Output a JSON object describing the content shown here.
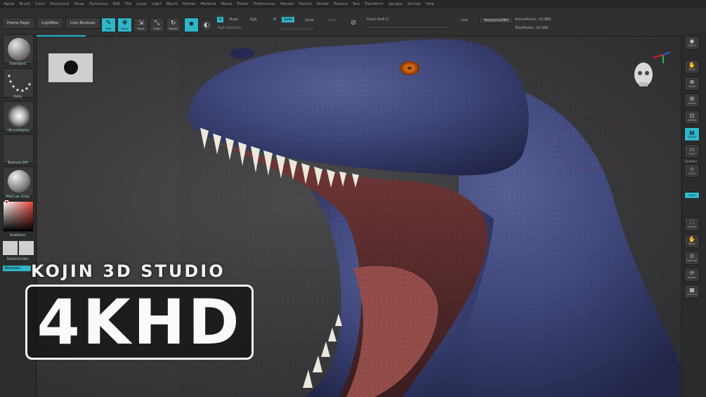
{
  "menu": [
    "Alpha",
    "Brush",
    "Color",
    "Document",
    "Draw",
    "Dynamics",
    "Edit",
    "File",
    "Layer",
    "Light",
    "Macro",
    "Marker",
    "Material",
    "Movie",
    "Picker",
    "Preferences",
    "Render",
    "Stencil",
    "Stroke",
    "Texture",
    "Tool",
    "Transform",
    "Zplugin",
    "Zscript",
    "Help"
  ],
  "toolbar": {
    "home_page": "Home Page",
    "lightbox": "LightBox",
    "live_boolean": "Live Boolean",
    "edit": "Edit",
    "draw": "Draw",
    "move": "Move",
    "scale": "Scale",
    "rotate": "Rotate",
    "a_chip": "A",
    "mrgb": "Mrgb",
    "rgb": "Rgb",
    "m": "M",
    "zadd": "Zadd",
    "zsub": "Zsub",
    "zcut": "Zcut",
    "rgb_intensity": "Rgb Intensity",
    "focal_shift": "Focal Shift 0",
    "last": "Last",
    "replay_last": "ReplayLastRel",
    "active_points": "ActivePoints: 10,968",
    "total_points": "TotalPoints: 10,968"
  },
  "left_tray": {
    "brush": "Standard",
    "stroke": "Dots",
    "alpha": "~BrushAlpha",
    "texture": "Texture Off",
    "material": "MatCap Gray",
    "gradient": "Gradient",
    "switch_color": "SwitchColor",
    "alternate": "Alternate"
  },
  "right_tray": {
    "spix": "SPix 3",
    "scroll": "Scroll",
    "zoom": "Zoom",
    "actual": "Actual",
    "aahalf": "AAHalf",
    "persp": "Persp",
    "floor": "Floor",
    "dynamic": "Dynamic",
    "local": "Local",
    "qxyz": "Qxyz",
    "frame": "Frame",
    "move": "Move",
    "zoom3d": "Zoom3D",
    "rotate": "Rotate",
    "line_fill": "Line Fill"
  },
  "overlay": {
    "studio": "KOJIN 3D STUDIO",
    "badge": "4KHD"
  },
  "colors": {
    "accent": "#2fb6c9",
    "dino_base": "#3e4779"
  }
}
